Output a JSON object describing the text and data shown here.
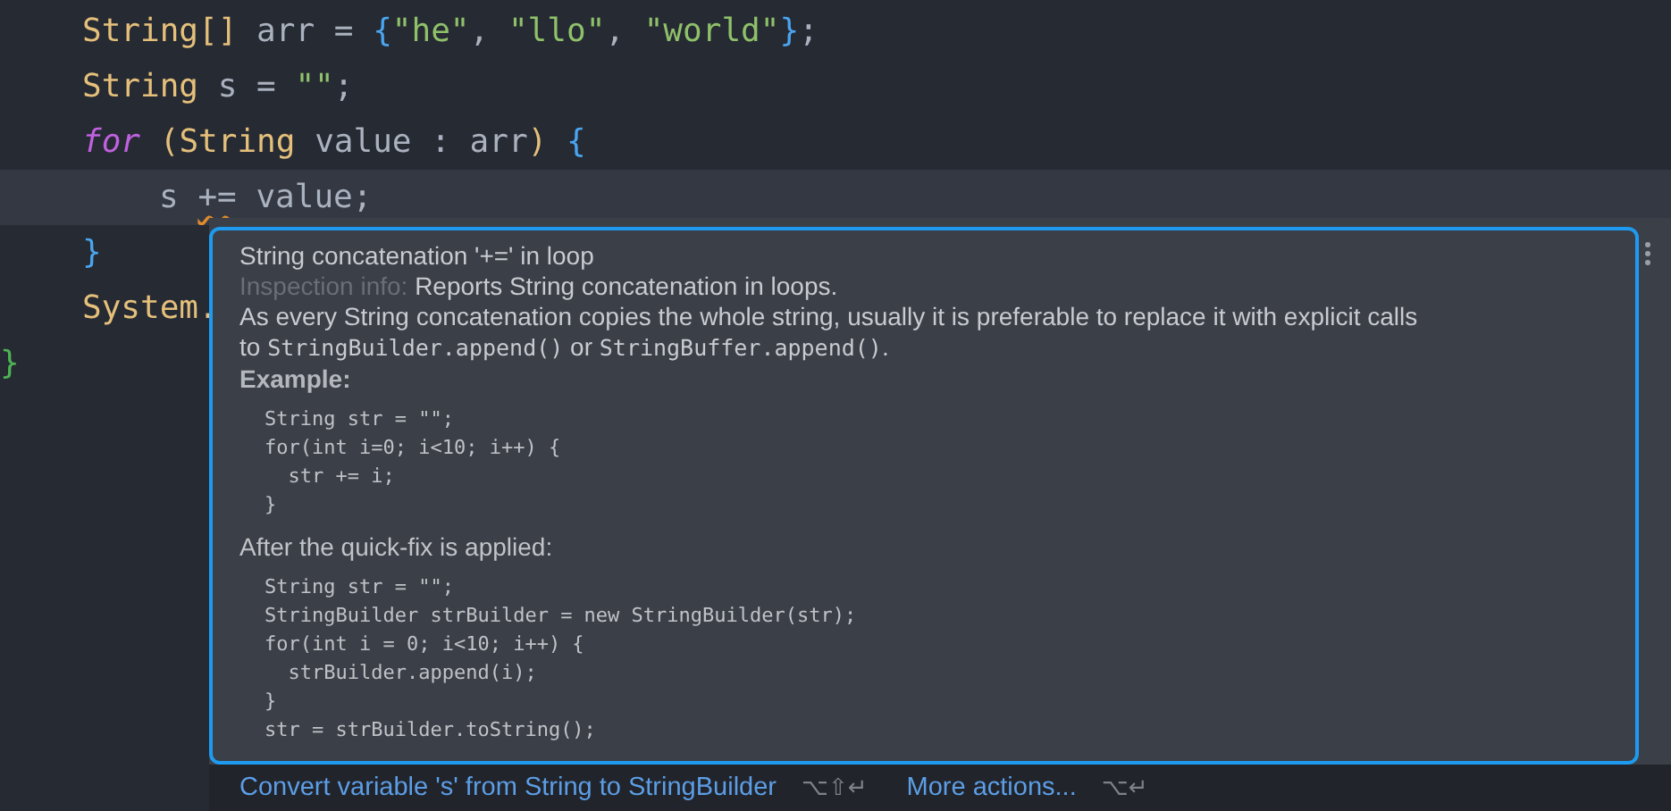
{
  "code_lines": [
    {
      "highlighted": false,
      "indented": false,
      "tokens": [
        {
          "kind": "type",
          "text": "String"
        },
        {
          "kind": "bracket",
          "text": "[]"
        },
        {
          "kind": "plain",
          "text": " arr = "
        },
        {
          "kind": "brace",
          "text": "{"
        },
        {
          "kind": "string",
          "text": "\"he\""
        },
        {
          "kind": "plain",
          "text": ", "
        },
        {
          "kind": "string",
          "text": "\"llo\""
        },
        {
          "kind": "plain",
          "text": ", "
        },
        {
          "kind": "string",
          "text": "\"world\""
        },
        {
          "kind": "brace",
          "text": "}"
        },
        {
          "kind": "plain",
          "text": ";"
        }
      ]
    },
    {
      "highlighted": false,
      "indented": false,
      "tokens": [
        {
          "kind": "type",
          "text": "String"
        },
        {
          "kind": "plain",
          "text": " s = "
        },
        {
          "kind": "string",
          "text": "\"\""
        },
        {
          "kind": "plain",
          "text": ";"
        }
      ]
    },
    {
      "highlighted": false,
      "indented": false,
      "tokens": [
        {
          "kind": "keyword",
          "text": "for"
        },
        {
          "kind": "bracket",
          "text": " ("
        },
        {
          "kind": "type",
          "text": "String"
        },
        {
          "kind": "plain",
          "text": " value : arr"
        },
        {
          "kind": "bracket",
          "text": ")"
        },
        {
          "kind": "brace",
          "text": " {"
        }
      ]
    },
    {
      "highlighted": true,
      "indented": true,
      "tokens": [
        {
          "kind": "plain",
          "text": "s "
        },
        {
          "kind": "warning",
          "text": "+="
        },
        {
          "kind": "plain",
          "text": " value;"
        }
      ]
    },
    {
      "highlighted": false,
      "indented": false,
      "tokens": [
        {
          "kind": "brace",
          "text": "}"
        }
      ]
    },
    {
      "highlighted": false,
      "indented": false,
      "tokens": [
        {
          "kind": "type",
          "text": "System."
        }
      ]
    },
    {
      "highlighted": false,
      "indented": false,
      "outer": true,
      "tokens": [
        {
          "kind": "outer",
          "text": "}"
        }
      ]
    }
  ],
  "popup": {
    "title": "String concatenation '+=' in loop",
    "info_label": "Inspection info:",
    "info_text": "Reports String concatenation in loops.",
    "description": [
      [
        {
          "kind": "text",
          "text": "As every String concatenation copies the whole string, usually it is preferable to replace it with explicit calls"
        }
      ],
      [
        {
          "kind": "text",
          "text": "to "
        },
        {
          "kind": "code",
          "text": "StringBuilder.append()"
        },
        {
          "kind": "text",
          "text": " or "
        },
        {
          "kind": "code",
          "text": "StringBuffer.append()"
        },
        {
          "kind": "text",
          "text": "."
        }
      ]
    ],
    "sections": [
      {
        "heading": "Example:",
        "bold": true,
        "code": [
          "String str = \"\";",
          "for(int i=0; i<10; i++) {",
          "  str += i;",
          "}"
        ]
      },
      {
        "heading": "After the quick-fix is applied:",
        "bold": false,
        "code": [
          "String str = \"\";",
          "StringBuilder strBuilder = new StringBuilder(str);",
          "for(int i = 0; i<10; i++) {",
          "  strBuilder.append(i);",
          "}",
          "str = strBuilder.toString();"
        ]
      }
    ]
  },
  "actions": [
    {
      "label": "Convert variable 's' from String to StringBuilder",
      "shortcut": "⌥⇧↵"
    },
    {
      "label": "More actions...",
      "shortcut": "⌥↵"
    }
  ]
}
